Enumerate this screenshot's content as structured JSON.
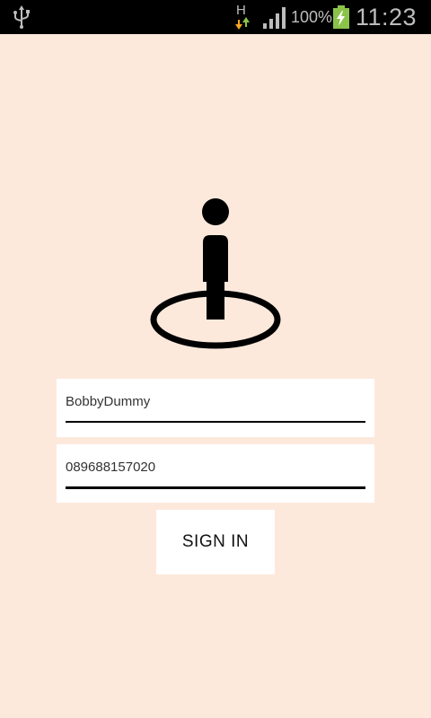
{
  "status_bar": {
    "network_type": "H",
    "battery_percent": "100%",
    "time": "11:23",
    "icons": [
      "usb-icon",
      "data-arrows-icon",
      "signal-icon",
      "battery-charging-icon"
    ],
    "battery_color": "#8BC34A"
  },
  "login": {
    "logo_icon": "person-location-icon",
    "username_value": "BobbyDummy",
    "phone_value": "089688157020",
    "sign_in_label": "SIGN IN"
  },
  "theme": {
    "background": "#FDE9DC",
    "card": "#FFFFFF",
    "text": "#333333"
  }
}
